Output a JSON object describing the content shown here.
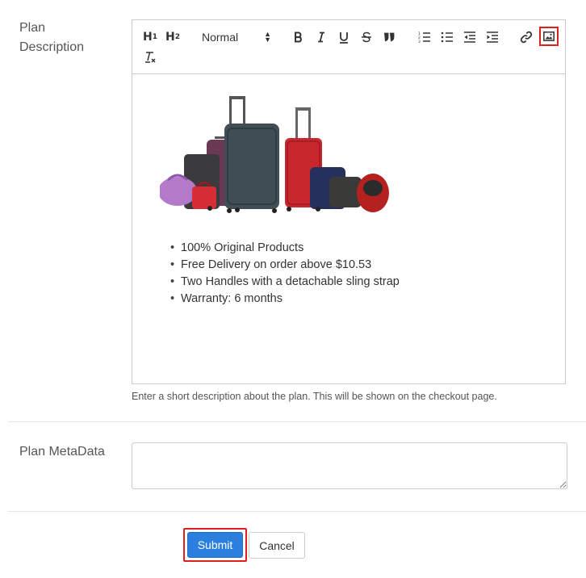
{
  "form": {
    "description_label": "Plan Description",
    "description_help": "Enter a short description about the plan. This will be shown on the checkout page.",
    "metadata_label": "Plan MetaData",
    "metadata_value": ""
  },
  "toolbar": {
    "h1": "H",
    "h1_sub": "1",
    "h2": "H",
    "h2_sub": "2",
    "format_value": "Normal",
    "icons": [
      "bold-icon",
      "italic-icon",
      "underline-icon",
      "strikethrough-icon",
      "blockquote-icon",
      "ordered-list-icon",
      "bullet-list-icon",
      "outdent-icon",
      "indent-icon",
      "link-icon",
      "image-icon",
      "clear-format-icon"
    ]
  },
  "content": {
    "bullets": [
      "100% Original Products",
      "Free Delivery on order above $10.53",
      "Two Handles with a detachable sling strap",
      "Warranty: 6 months"
    ]
  },
  "actions": {
    "submit_label": "Submit",
    "cancel_label": "Cancel"
  },
  "colors": {
    "primary": "#2b7fde",
    "highlight": "#e02020",
    "border": "#cccccc"
  }
}
